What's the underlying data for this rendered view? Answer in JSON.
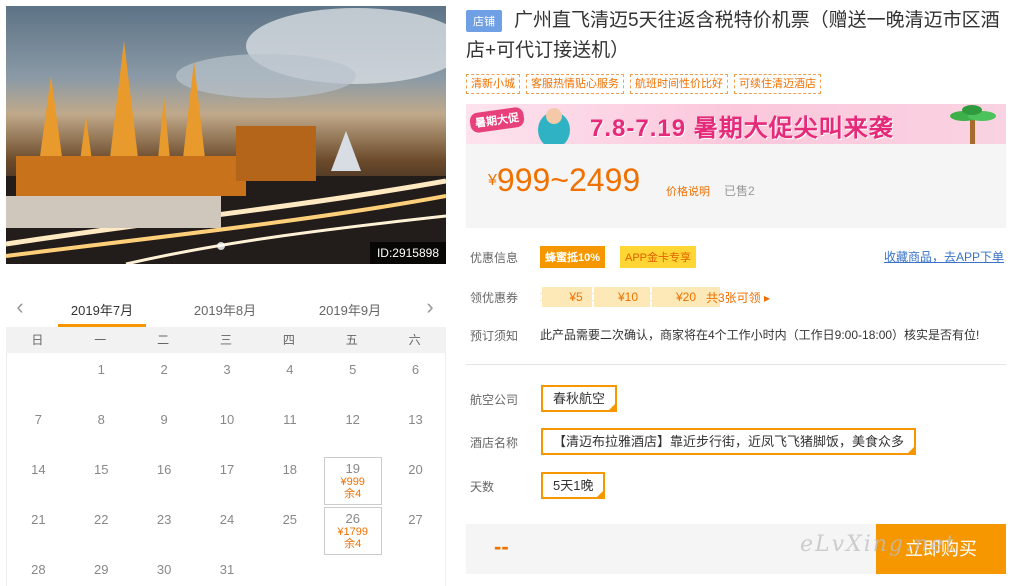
{
  "hero": {
    "image_id": "ID:2915898"
  },
  "calendar": {
    "prev_icon": "chevron-left-icon",
    "next_icon": "chevron-right-icon",
    "months": [
      "2019年7月",
      "2019年8月",
      "2019年9月"
    ],
    "weekdays": [
      "日",
      "一",
      "二",
      "三",
      "四",
      "五",
      "六"
    ],
    "days": [
      [
        "",
        "1",
        "2",
        "3",
        "4",
        "5",
        "6"
      ],
      [
        "7",
        "8",
        "9",
        "10",
        "11",
        "12",
        "13"
      ],
      [
        "14",
        "15",
        "16",
        "17",
        "18",
        "19",
        "20"
      ],
      [
        "21",
        "22",
        "23",
        "24",
        "25",
        "26",
        "27"
      ],
      [
        "28",
        "29",
        "30",
        "31",
        "",
        "",
        ""
      ]
    ],
    "available": [
      {
        "day": "19",
        "price": "¥999",
        "stock": "余4"
      },
      {
        "day": "26",
        "price": "¥1799",
        "stock": "余4"
      }
    ]
  },
  "product": {
    "store_badge": "店铺",
    "title": "广州直飞清迈5天往返含税特价机票（赠送一晚清迈市区酒店+可代订接送机）",
    "tags": [
      "清新小城",
      "客服热情贴心服务",
      "航班时间性价比好",
      "可续住清迈酒店"
    ]
  },
  "promo": {
    "tag": "暑期大促",
    "text": "7.8-7.19 暑期大促尖叫来袭"
  },
  "price": {
    "currency": "¥",
    "range": "999~2499",
    "note": "价格说明",
    "sold": "已售2"
  },
  "offers": {
    "label": "优惠信息",
    "badges": [
      "蜂蜜抵10%",
      "APP金卡专享"
    ],
    "fav_link": "收藏商品，去APP下单"
  },
  "coupons": {
    "label": "领优惠券",
    "items": [
      "¥5",
      "¥10",
      "¥20"
    ],
    "more": "共3张可领 ▸"
  },
  "notice": {
    "label": "预订须知",
    "text": "此产品需要二次确认，商家将在4个工作小时内（工作日9:00-18:00）核实是否有位!"
  },
  "options": {
    "airline_label": "航空公司",
    "airline": "春秋航空",
    "hotel_label": "酒店名称",
    "hotel": "【清迈布拉雅酒店】靠近步行街，近凤飞飞猪脚饭，美食众多",
    "days_label": "天数",
    "days": "5天1晚"
  },
  "buy": {
    "total": "--",
    "button": "立即购买"
  },
  "watermark": "eLvXing.net",
  "colors": {
    "accent": "#f79700",
    "price": "#f07000",
    "link": "#3973c9"
  }
}
